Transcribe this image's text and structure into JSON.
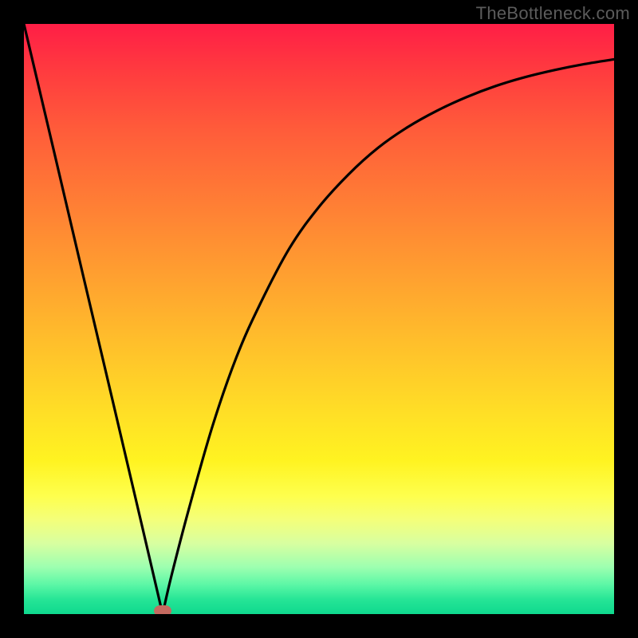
{
  "watermark": {
    "text": "TheBottleneck.com"
  },
  "chart_data": {
    "type": "line",
    "title": "",
    "xlabel": "",
    "ylabel": "",
    "xlim": [
      0,
      1
    ],
    "ylim": [
      0,
      1
    ],
    "series": [
      {
        "name": "bottleneck-curve",
        "x": [
          0.0,
          0.05,
          0.1,
          0.15,
          0.2,
          0.235,
          0.25,
          0.28,
          0.32,
          0.36,
          0.4,
          0.45,
          0.5,
          0.55,
          0.6,
          0.65,
          0.7,
          0.75,
          0.8,
          0.85,
          0.9,
          0.95,
          1.0
        ],
        "y": [
          1.0,
          0.788,
          0.575,
          0.363,
          0.15,
          0.0,
          0.065,
          0.18,
          0.32,
          0.435,
          0.525,
          0.62,
          0.69,
          0.745,
          0.79,
          0.825,
          0.853,
          0.876,
          0.895,
          0.91,
          0.922,
          0.932,
          0.94
        ]
      }
    ],
    "annotations": [
      {
        "name": "min-marker",
        "x": 0.235,
        "y": 0.0
      }
    ],
    "background": "red-yellow-green vertical gradient"
  }
}
